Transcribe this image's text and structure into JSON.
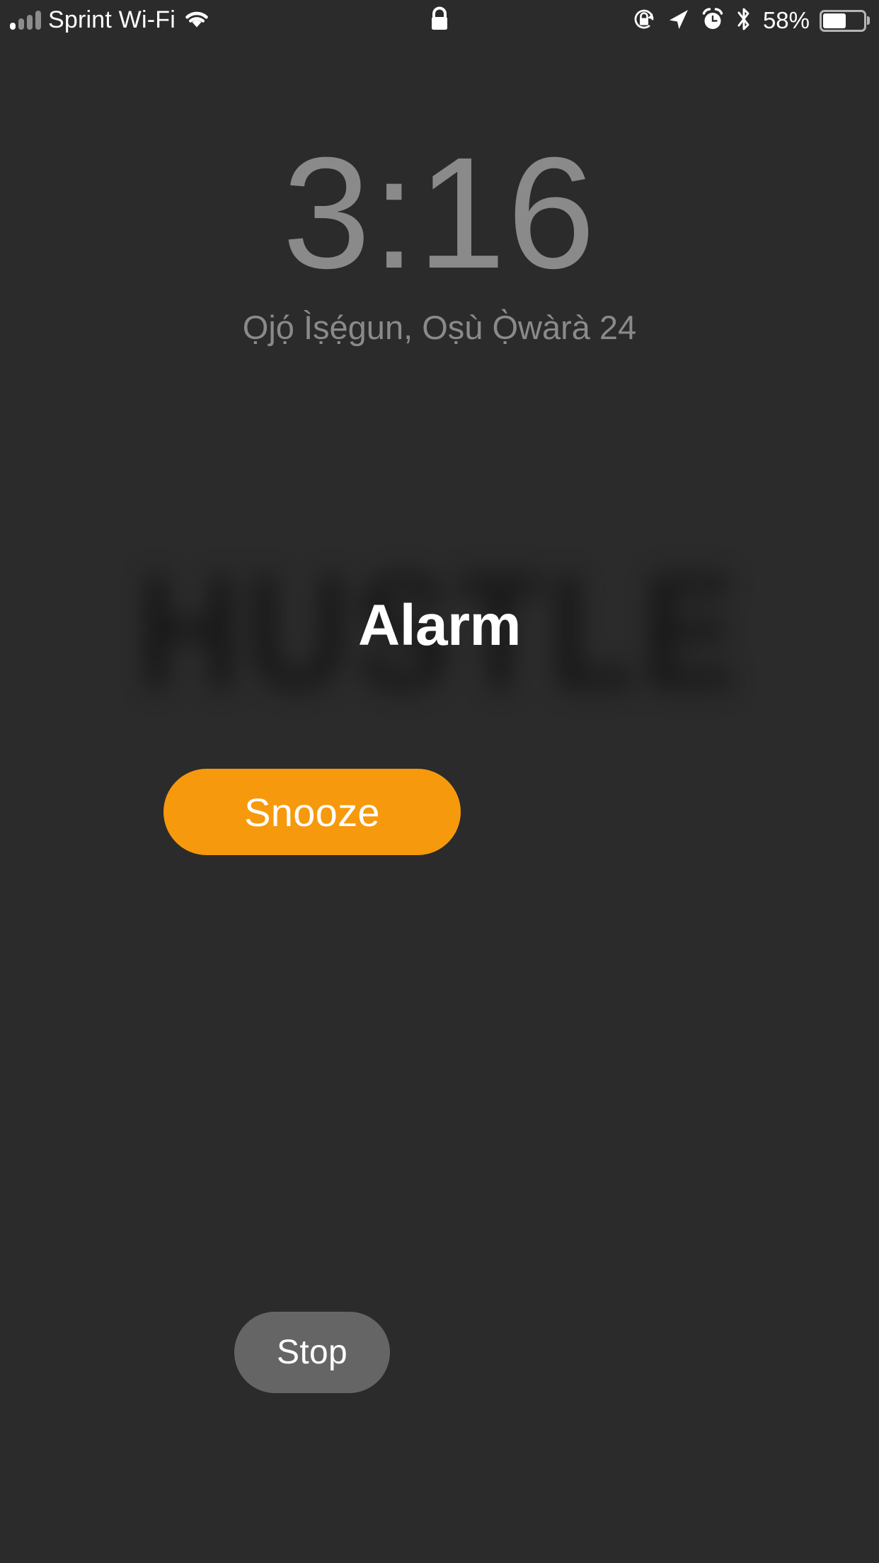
{
  "status_bar": {
    "carrier": "Sprint Wi-Fi",
    "battery_percent_label": "58%",
    "battery_level": 58,
    "icons": {
      "signal": "cellular-signal-icon",
      "wifi": "wifi-icon",
      "lock": "lock-icon",
      "rotation_lock": "rotation-lock-icon",
      "location": "location-arrow-icon",
      "alarm": "alarm-clock-icon",
      "bluetooth": "bluetooth-icon",
      "battery": "battery-icon"
    }
  },
  "lock_screen": {
    "time": "3:16",
    "date": "Ọjọ́ Ìṣẹ́gun, Oṣù Ọ̀wàrà 24"
  },
  "wallpaper": {
    "text": "HUSTLE"
  },
  "alarm": {
    "title": "Alarm",
    "snooze_label": "Snooze",
    "stop_label": "Stop"
  },
  "colors": {
    "background": "#2b2b2b",
    "snooze_accent": "#f7990c",
    "stop_grey": "#656565",
    "clock_grey": "#8a8a8a",
    "text_white": "#ffffff"
  }
}
